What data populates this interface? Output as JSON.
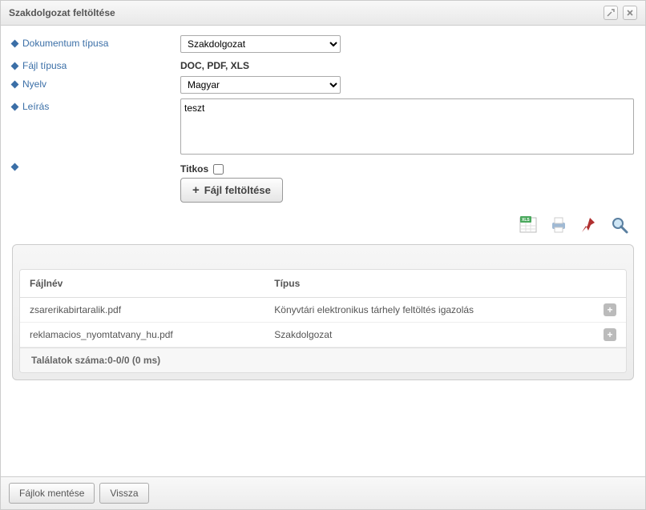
{
  "dialog": {
    "title": "Szakdolgozat feltöltése"
  },
  "form": {
    "doc_type": {
      "label": "Dokumentum típusa",
      "value": "Szakdolgozat"
    },
    "file_type": {
      "label": "Fájl típusa",
      "value": "DOC, PDF, XLS"
    },
    "language": {
      "label": "Nyelv",
      "value": "Magyar"
    },
    "description": {
      "label": "Leírás",
      "value": "teszt"
    },
    "secret": {
      "label": "Titkos",
      "checked": false
    },
    "upload_btn": "Fájl feltöltése"
  },
  "icons": {
    "xls": "xls-export-icon",
    "print": "print-icon",
    "pin": "pin-icon",
    "search": "search-icon"
  },
  "table": {
    "columns": {
      "filename": "Fájlnév",
      "type": "Típus"
    },
    "rows": [
      {
        "filename": "zsarerikabirtaralik.pdf",
        "type": "Könyvtári elektronikus tárhely feltöltés igazolás"
      },
      {
        "filename": "reklamacios_nyomtatvany_hu.pdf",
        "type": "Szakdolgozat"
      }
    ],
    "footer": "Találatok száma:0-0/0 (0 ms)"
  },
  "buttons": {
    "save": "Fájlok mentése",
    "back": "Vissza"
  }
}
